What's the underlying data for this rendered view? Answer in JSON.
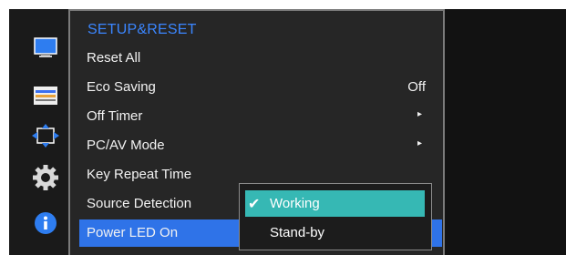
{
  "menu": {
    "title": "SETUP&RESET",
    "items": [
      {
        "label": "Reset All",
        "value": ""
      },
      {
        "label": "Eco Saving",
        "value": "Off"
      },
      {
        "label": "Off Timer",
        "arrow": "▸"
      },
      {
        "label": "PC/AV Mode",
        "arrow": "▸"
      },
      {
        "label": "Key Repeat Time"
      },
      {
        "label": "Source Detection"
      },
      {
        "label": "Power LED On"
      }
    ]
  },
  "popup": {
    "options": [
      {
        "label": "Working",
        "check": "✔"
      },
      {
        "label": "Stand-by"
      }
    ]
  },
  "sidebar": {
    "icons": [
      "monitor-icon",
      "color-bars-icon",
      "resize-icon",
      "gear-icon",
      "info-icon"
    ]
  },
  "colors": {
    "title_blue": "#3b86ff",
    "selected_blue": "#2f73e8",
    "popup_teal": "#36b8b4"
  }
}
